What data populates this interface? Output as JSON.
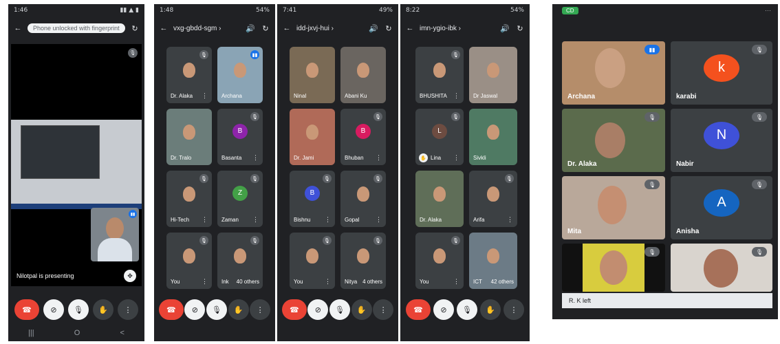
{
  "phone1": {
    "time": "1:46",
    "status_right": "▮▮ ▲ ▮",
    "search_placeholder": "Phone unlocked with fingerprint",
    "presenting_text": "Nilotpal is presenting",
    "nav": [
      "|||",
      "O",
      "<"
    ]
  },
  "phone2": {
    "time": "1:48",
    "status_right": "54%",
    "title": "vxg-gbdd-sgm ›",
    "tiles": [
      "Dr. Alaka",
      "Archana",
      "Dr. Tralo",
      "Basanta",
      "Hi-Tech",
      "Zaman",
      "You",
      "Ink"
    ],
    "others_label": "40 others",
    "avatar_letters": {
      "basanta": "B",
      "zaman": "Z"
    }
  },
  "phone3": {
    "time": "7:41",
    "status_right": "49%",
    "title": "idd-jxvj-hui ›",
    "tiles": [
      "Ninal",
      "Abani Ku",
      "Dr. Jami",
      "Bhuban",
      "Bishnu",
      "Gopal",
      "You",
      "Nitya"
    ],
    "others_label": "4 others",
    "avatar_letters": {
      "bhuban": "B",
      "bishnu": "B"
    }
  },
  "phone4": {
    "time": "8:22",
    "status_right": "54%",
    "title": "imn-ygio-ibk ›",
    "tiles": [
      "BHUSHITA",
      "Dr Jaswal",
      "Lina",
      "Sivkli",
      "Dr. Alaka",
      "Arifa",
      "You",
      "ICT"
    ],
    "others_label": "42 others",
    "avatar_letters": {
      "lina": "L"
    }
  },
  "right_panel": {
    "badge": "CD",
    "tiles": [
      "Archana",
      "karabi",
      "Dr. Alaka",
      "Nabir",
      "Mita",
      "Anisha"
    ],
    "avatar_letters": {
      "karabi": "k",
      "nabir": "N",
      "anisha": "A"
    },
    "left_notice": "R. K left"
  },
  "colors": {
    "bg": "#202124",
    "tile": "#3c4043",
    "hangup": "#ea4335",
    "avatar_pink": "#d81b60",
    "avatar_purple": "#8e24aa",
    "avatar_green": "#43a047",
    "avatar_brown": "#6d4c41",
    "avatar_blue": "#1e4fbf",
    "avatar_orange": "#f4511e",
    "avatar_indigo": "#3f51d8",
    "avatar_cyan": "#1565c0"
  }
}
